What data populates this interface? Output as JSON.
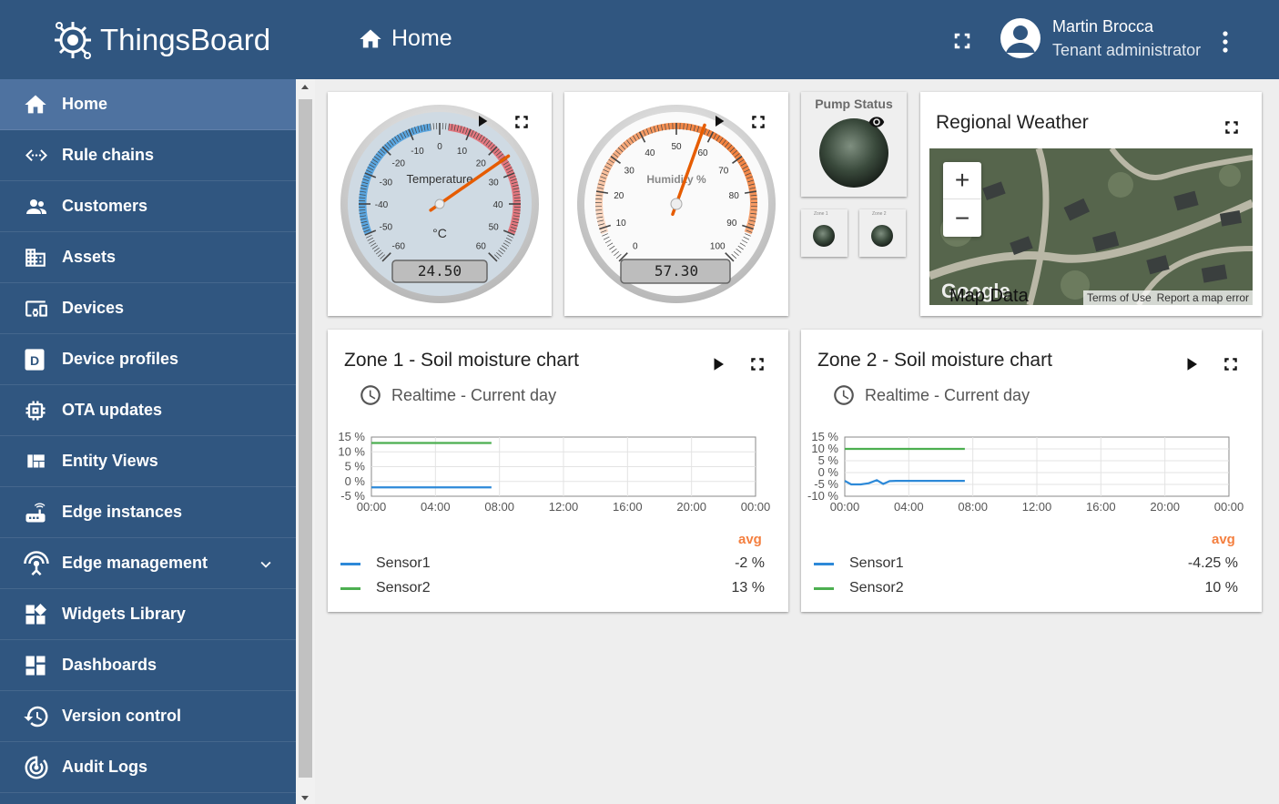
{
  "app": {
    "title": "ThingsBoard"
  },
  "header": {
    "page_title": "Home",
    "user_name": "Martin Brocca",
    "user_role": "Tenant administrator"
  },
  "sidebar": {
    "items": [
      {
        "label": "Home",
        "icon": "home-icon"
      },
      {
        "label": "Rule chains",
        "icon": "settings-ethernet-icon"
      },
      {
        "label": "Customers",
        "icon": "supervisor-account-icon"
      },
      {
        "label": "Assets",
        "icon": "domain-icon"
      },
      {
        "label": "Devices",
        "icon": "devices-other-icon"
      },
      {
        "label": "Device profiles",
        "icon": "device-profile-icon"
      },
      {
        "label": "OTA updates",
        "icon": "memory-icon"
      },
      {
        "label": "Entity Views",
        "icon": "view-quilt-icon"
      },
      {
        "label": "Edge instances",
        "icon": "router-icon"
      },
      {
        "label": "Edge management",
        "icon": "settings-input-antenna-icon"
      },
      {
        "label": "Widgets Library",
        "icon": "widgets-icon"
      },
      {
        "label": "Dashboards",
        "icon": "dashboards-icon"
      },
      {
        "label": "Version control",
        "icon": "history-icon"
      },
      {
        "label": "Audit Logs",
        "icon": "track-changes-icon"
      }
    ]
  },
  "widgets": {
    "temperature": {
      "label": "Temperature",
      "units": "°C",
      "value": "24.50",
      "ticks": [
        "-60",
        "-50",
        "-40",
        "-30",
        "-20",
        "-10",
        "0",
        "10",
        "20",
        "30",
        "40",
        "50",
        "60"
      ],
      "min": -60,
      "max": 60,
      "reading": 24.5
    },
    "humidity": {
      "label": "Humidity %",
      "value": "57.30",
      "ticks": [
        "0",
        "10",
        "20",
        "30",
        "40",
        "50",
        "60",
        "70",
        "80",
        "90",
        "100"
      ],
      "min": 0,
      "max": 100,
      "reading": 57.3
    },
    "pump": {
      "title": "Pump Status",
      "zone1": "Zone 1",
      "zone2": "Zone 2"
    },
    "weather": {
      "title": "Regional Weather",
      "zoom_in": "+",
      "zoom_out": "−",
      "google": "Google",
      "map_data": "Map Data",
      "terms": "Terms of Use",
      "report": "Report a map error"
    },
    "zone1": {
      "title": "Zone 1 - Soil moisture chart",
      "timewindow": "Realtime - Current day",
      "avg_label": "avg",
      "legend": [
        {
          "name": "Sensor1",
          "avg": "-2 %"
        },
        {
          "name": "Sensor2",
          "avg": "13 %"
        }
      ]
    },
    "zone2": {
      "title": "Zone 2 - Soil moisture chart",
      "timewindow": "Realtime - Current day",
      "avg_label": "avg",
      "legend": [
        {
          "name": "Sensor1",
          "avg": "-4.25 %"
        },
        {
          "name": "Sensor2",
          "avg": "10 %"
        }
      ]
    }
  },
  "colors": {
    "primary": "#305680",
    "active": "#4e72a0",
    "sensor1": "#2d89d8",
    "sensor2": "#4caf50",
    "avg": "#f47f3f"
  },
  "chart_data": [
    {
      "type": "line",
      "xlabels": [
        "00:00",
        "04:00",
        "08:00",
        "12:00",
        "16:00",
        "20:00",
        "00:00"
      ],
      "ylabels": [
        "15 %",
        "10 %",
        "5 %",
        "0 %",
        "-5 %"
      ],
      "ylim": [
        -5,
        15
      ],
      "series": [
        {
          "name": "Sensor1",
          "x": [
            0,
            7.5
          ],
          "y": [
            -2,
            -2
          ]
        },
        {
          "name": "Sensor2",
          "x": [
            0,
            7.5
          ],
          "y": [
            13,
            13
          ]
        }
      ]
    },
    {
      "type": "line",
      "xlabels": [
        "00:00",
        "04:00",
        "08:00",
        "12:00",
        "16:00",
        "20:00",
        "00:00"
      ],
      "ylabels": [
        "15 %",
        "10 %",
        "5 %",
        "0 %",
        "-5 %",
        "-10 %"
      ],
      "ylim": [
        -10,
        15
      ],
      "series": [
        {
          "name": "Sensor1",
          "x": [
            0,
            0.4,
            1,
            1.5,
            2,
            2.4,
            2.8,
            3.2,
            7.5
          ],
          "y": [
            -3.5,
            -5,
            -5,
            -4.5,
            -3.2,
            -4.8,
            -3.6,
            -3.5,
            -3.5
          ]
        },
        {
          "name": "Sensor2",
          "x": [
            0,
            7.5
          ],
          "y": [
            10,
            10
          ]
        }
      ]
    }
  ]
}
